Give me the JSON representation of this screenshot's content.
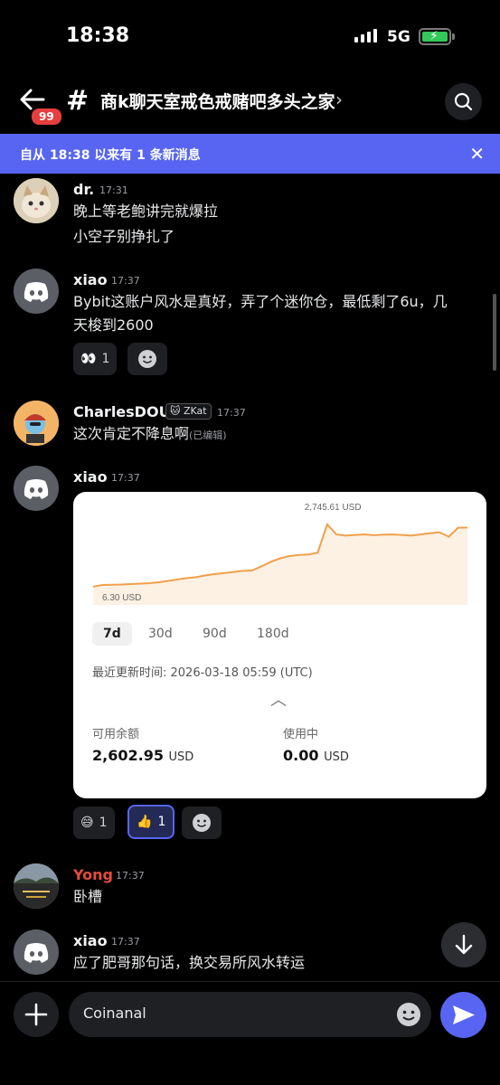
{
  "status": {
    "time": "18:38",
    "network": "5G"
  },
  "header": {
    "unread_badge": "99",
    "hash": "#",
    "channel": "商k聊天室戒色戒赌吧多头之家",
    "chevron": "›"
  },
  "banner": {
    "text": "自从 18:38 以来有 1 条新消息",
    "close": "✕"
  },
  "messages": [
    {
      "author": "dr.",
      "time": "17:31",
      "lines": [
        "晚上等老鲍讲完就爆拉",
        "小空子别挣扎了"
      ]
    },
    {
      "author": "xiao",
      "time": "17:37",
      "lines": [
        "Bybit这账户风水是真好，弄了个迷你仓，最低剩了6u，几",
        "天梭到2600"
      ],
      "reaction": {
        "emoji": "👀",
        "count": "1"
      }
    },
    {
      "author": "CharlesDOU",
      "time": "17:37",
      "tag": "ZKat",
      "lines": [
        "这次肯定不降息啊"
      ],
      "edited": "(已编辑)"
    },
    {
      "author": "xiao",
      "time": "17:37"
    },
    {
      "author": "Yong",
      "time": "17:37",
      "lines": [
        "卧槽"
      ],
      "author_color": "#e74c3c"
    },
    {
      "author": "xiao",
      "time": "17:37",
      "lines": [
        "应了肥哥那句话，换交易所风水转运"
      ]
    }
  ],
  "reactions2": [
    {
      "emoji": "😅",
      "count": "1"
    },
    {
      "emoji": "👍",
      "count": "1"
    }
  ],
  "card": {
    "max_label": "2,745.61 USD",
    "min_label": "6.30 USD",
    "ranges": [
      "7d",
      "30d",
      "90d",
      "180d"
    ],
    "selected_range": "7d",
    "updated": "最近更新时间:   2026-03-18 05:59 (UTC)",
    "available_label": "可用余额",
    "available_value": "2,602.95",
    "in_use_label": "使用中",
    "in_use_value": "0.00",
    "currency": "USD",
    "accent": "#f0a04b"
  },
  "chart_data": {
    "type": "line",
    "title": "",
    "x": [
      0,
      1,
      2,
      3,
      4,
      5,
      6,
      7,
      8,
      9,
      10,
      11,
      12,
      13,
      14,
      15,
      16,
      17,
      18,
      19,
      20,
      21,
      22,
      23,
      24,
      25,
      26,
      27,
      28,
      29,
      30,
      31,
      32,
      33,
      34,
      35,
      36,
      37,
      38,
      39,
      40
    ],
    "values": [
      6.3,
      80,
      90,
      100,
      120,
      140,
      160,
      200,
      260,
      320,
      380,
      420,
      500,
      560,
      600,
      650,
      700,
      720,
      900,
      1100,
      1250,
      1350,
      1400,
      1420,
      1500,
      2745.61,
      2300,
      2250,
      2280,
      2300,
      2270,
      2290,
      2300,
      2280,
      2250,
      2300,
      2350,
      2400,
      2200,
      2600,
      2602.95
    ],
    "annotations": [
      "2,745.61 USD",
      "6.30 USD"
    ],
    "ylabel": "",
    "xlabel": "",
    "ylim": [
      0,
      2900
    ]
  },
  "input": {
    "value": "Coinanal"
  }
}
